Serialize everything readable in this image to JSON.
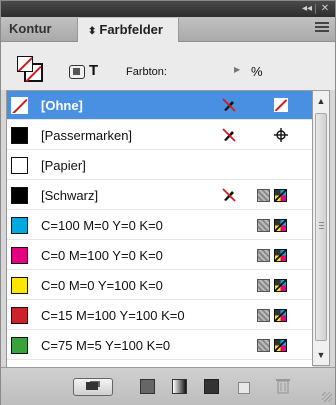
{
  "panel": {
    "collapse_glyph": "◂◂",
    "close_glyph": "✕"
  },
  "tabs": [
    {
      "label": "Kontur",
      "active": false
    },
    {
      "label": "Farbfelder",
      "active": true
    }
  ],
  "toolbar": {
    "text_format_glyph": "T",
    "tint_label": "Farbton:",
    "tint_value": "",
    "tint_unit": "%"
  },
  "swatches": [
    {
      "name": "[Ohne]",
      "color": "none",
      "selected": true,
      "icons": [
        "no-edit-icon",
        "none-icon"
      ]
    },
    {
      "name": "[Passermarken]",
      "color": "#000000",
      "selected": false,
      "icons": [
        "no-edit-icon",
        "registration-icon"
      ]
    },
    {
      "name": "[Papier]",
      "color": "#ffffff",
      "selected": false,
      "icons": []
    },
    {
      "name": "[Schwarz]",
      "color": "#000000",
      "selected": false,
      "icons": [
        "no-edit-icon",
        "process-icon",
        "cmyk-icon"
      ]
    },
    {
      "name": "C=100 M=0 Y=0 K=0",
      "color": "#00a8e0",
      "selected": false,
      "icons": [
        "process-icon",
        "cmyk-icon"
      ]
    },
    {
      "name": "C=0 M=100 Y=0 K=0",
      "color": "#e40080",
      "selected": false,
      "icons": [
        "process-icon",
        "cmyk-icon"
      ]
    },
    {
      "name": "C=0 M=0 Y=100 K=0",
      "color": "#ffe600",
      "selected": false,
      "icons": [
        "process-icon",
        "cmyk-icon"
      ]
    },
    {
      "name": "C=15 M=100 Y=100 K=0",
      "color": "#cc2229",
      "selected": false,
      "icons": [
        "process-icon",
        "cmyk-icon"
      ]
    },
    {
      "name": "C=75 M=5 Y=100 K=0",
      "color": "#3aa23d",
      "selected": false,
      "icons": [
        "process-icon",
        "cmyk-icon"
      ]
    }
  ],
  "colors": {
    "selection": "#4a90e2",
    "none_slash": "#d21c1c"
  }
}
